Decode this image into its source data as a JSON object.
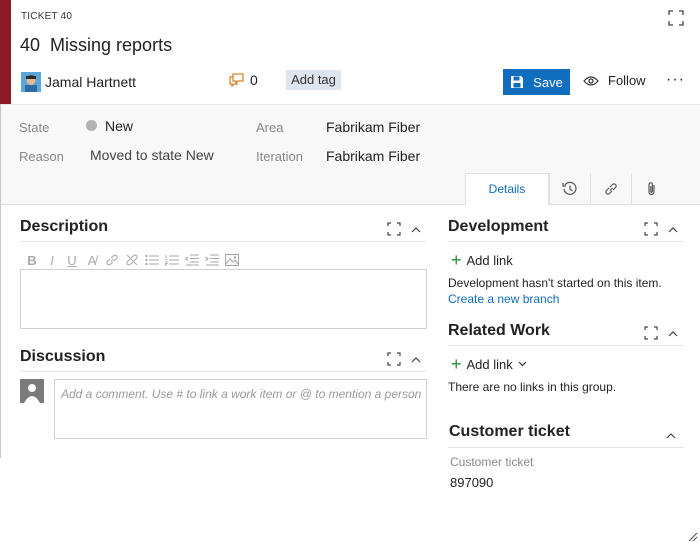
{
  "header": {
    "ticket_label": "TICKET 40",
    "ticket_id": "40",
    "title": "Missing reports",
    "assignee": "Jamal Hartnett",
    "comment_count": "0",
    "add_tag_label": "Add tag",
    "save_label": "Save",
    "follow_label": "Follow",
    "more_label": "···",
    "accent_color": "#8b1a26"
  },
  "fields": {
    "state_label": "State",
    "state_value": "New",
    "reason_label": "Reason",
    "reason_value": "Moved to state New",
    "area_label": "Area",
    "area_value": "Fabrikam Fiber",
    "iteration_label": "Iteration",
    "iteration_value": "Fabrikam Fiber"
  },
  "tabs": {
    "details_label": "Details",
    "icons": [
      "history-icon",
      "links-icon",
      "attachment-icon"
    ]
  },
  "description": {
    "title": "Description",
    "toolbar_icons": [
      "bold-icon",
      "italic-icon",
      "underline-icon",
      "highlight-icon",
      "link-icon",
      "unlink-icon",
      "bullet-list-icon",
      "numbered-list-icon",
      "outdent-icon",
      "indent-icon",
      "image-icon"
    ]
  },
  "discussion": {
    "title": "Discussion",
    "placeholder": "Add a comment. Use # to link a work item or @ to mention a person"
  },
  "development": {
    "title": "Development",
    "add_link": "Add link",
    "status_text": "Development hasn't started on this item.",
    "create_branch": "Create a new branch"
  },
  "related_work": {
    "title": "Related Work",
    "add_link": "Add link",
    "empty_text": "There are no links in this group."
  },
  "customer_ticket": {
    "title": "Customer ticket",
    "field_label": "Customer ticket",
    "field_value": "897090"
  },
  "colors": {
    "primary": "#106ebe",
    "add_green": "#2f8f3c",
    "comment_orange": "#d9822b"
  }
}
